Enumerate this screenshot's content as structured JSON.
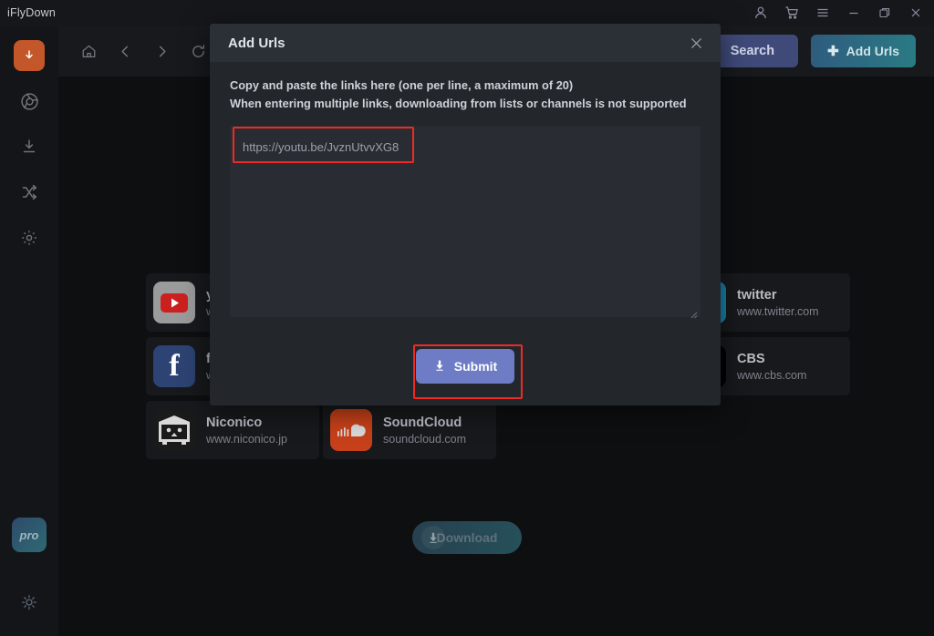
{
  "app": {
    "title": "iFlyDown"
  },
  "titlebar": {
    "controls": [
      {
        "name": "account-icon",
        "label": "Account"
      },
      {
        "name": "cart-icon",
        "label": "Cart"
      },
      {
        "name": "menu-icon",
        "label": "Menu"
      },
      {
        "name": "minimize-icon",
        "label": "Minimize"
      },
      {
        "name": "restore-icon",
        "label": "Restore"
      },
      {
        "name": "close-icon",
        "label": "Close"
      }
    ]
  },
  "sidebar": {
    "items": [
      {
        "name": "downloader-icon",
        "label": "Downloader",
        "active": true
      },
      {
        "name": "browser-icon",
        "label": "Browser",
        "active": false
      },
      {
        "name": "download-icon",
        "label": "Downloads",
        "active": false
      },
      {
        "name": "convert-icon",
        "label": "Converter",
        "active": false
      },
      {
        "name": "settings-gear-icon",
        "label": "Settings",
        "active": false
      }
    ],
    "pro_label": "pro",
    "theme_toggle": "brightness-icon"
  },
  "toolbar": {
    "nav": [
      {
        "name": "home-icon",
        "label": "Home"
      },
      {
        "name": "back-icon",
        "label": "Back"
      },
      {
        "name": "forward-icon",
        "label": "Forward"
      },
      {
        "name": "reload-icon",
        "label": "Reload"
      }
    ],
    "search_value": "",
    "search_placeholder": "",
    "clear_icon": "clear-icon",
    "search_label": "Search",
    "add_urls_label": "Add Urls",
    "add_urls_icon": "plus-icon"
  },
  "sites": [
    {
      "name": "youtube",
      "title": "yo",
      "url": "ww",
      "icon": "youtube-icon"
    },
    {
      "name": "site-2",
      "title": "",
      "url": "",
      "icon": ""
    },
    {
      "name": "site-3",
      "title": "",
      "url": "",
      "icon": ""
    },
    {
      "name": "twitter",
      "title": "twitter",
      "url": "www.twitter.com",
      "icon": "twitter-icon"
    },
    {
      "name": "facebook",
      "title": "fa",
      "url": "ww",
      "icon": "facebook-icon"
    },
    {
      "name": "site-6",
      "title": "",
      "url": "",
      "icon": ""
    },
    {
      "name": "site-7",
      "title": "",
      "url": "",
      "icon": ""
    },
    {
      "name": "cbs",
      "title": "CBS",
      "url": "www.cbs.com",
      "icon": "cbs-icon"
    },
    {
      "name": "niconico",
      "title": "Niconico",
      "url": "www.niconico.jp",
      "icon": "niconico-icon"
    },
    {
      "name": "soundcloud",
      "title": "SoundCloud",
      "url": "soundcloud.com",
      "icon": "soundcloud-icon"
    }
  ],
  "download_button": {
    "label": "Download",
    "icon": "download-arrow-icon",
    "enabled": false
  },
  "modal": {
    "title": "Add Urls",
    "close_icon": "close-icon",
    "hint_line1": "Copy and paste the links here (one per line, a maximum of 20)",
    "hint_line2": "When entering multiple links, downloading from lists or channels is not supported",
    "urls_value": "https://youtu.be/JvznUtvvXG8",
    "urls_placeholder": "",
    "submit_label": "Submit",
    "submit_icon": "download-arrow-icon"
  },
  "annotations": {
    "color": "#ef2a24",
    "targets": [
      "url-input-text",
      "submit-button"
    ]
  },
  "colors": {
    "accent_orange": "#c4572a",
    "submit_blue": "#6d7cc4",
    "search_blue": "#3f4a79",
    "add_urls_teal": "#2a7b84",
    "window_bg": "#0e0f11",
    "modal_bg": "#23272c",
    "annotation_red": "#ef2a24"
  }
}
